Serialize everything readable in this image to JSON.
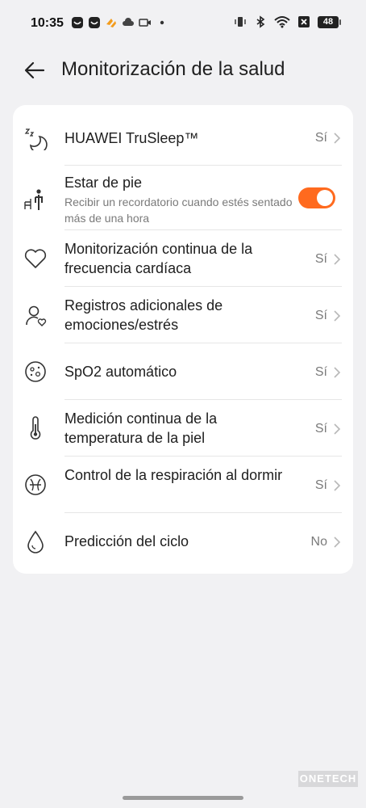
{
  "status_bar": {
    "time": "10:35",
    "battery": "48"
  },
  "header": {
    "title": "Monitorización de la salud"
  },
  "settings": [
    {
      "title": "HUAWEI TruSleep™",
      "value": "Sí",
      "icon": "sleep-moon-icon"
    },
    {
      "title": "Estar de pie",
      "subtitle": "Recibir un recordatorio cuando estés sentado más de una hora",
      "toggle": true,
      "icon": "standing-person-icon"
    },
    {
      "title": "Monitorización continua de la frecuencia cardíaca",
      "value": "Sí",
      "icon": "heart-icon"
    },
    {
      "title": "Registros adicionales de emociones/estrés",
      "value": "Sí",
      "icon": "emotion-person-icon"
    },
    {
      "title": "SpO2 automático",
      "value": "Sí",
      "icon": "spo2-icon"
    },
    {
      "title": "Medición continua de la temperatura de la piel",
      "value": "Sí",
      "icon": "thermometer-icon"
    },
    {
      "title": "Control de la respiración al dormir",
      "value": "Sí",
      "icon": "breathing-icon"
    },
    {
      "title": "Predicción del ciclo",
      "value": "No",
      "icon": "drop-icon"
    }
  ],
  "colors": {
    "accent": "#ff6a1e",
    "background": "#f1f1f3",
    "card": "#ffffff"
  },
  "watermark": "ONETECH"
}
